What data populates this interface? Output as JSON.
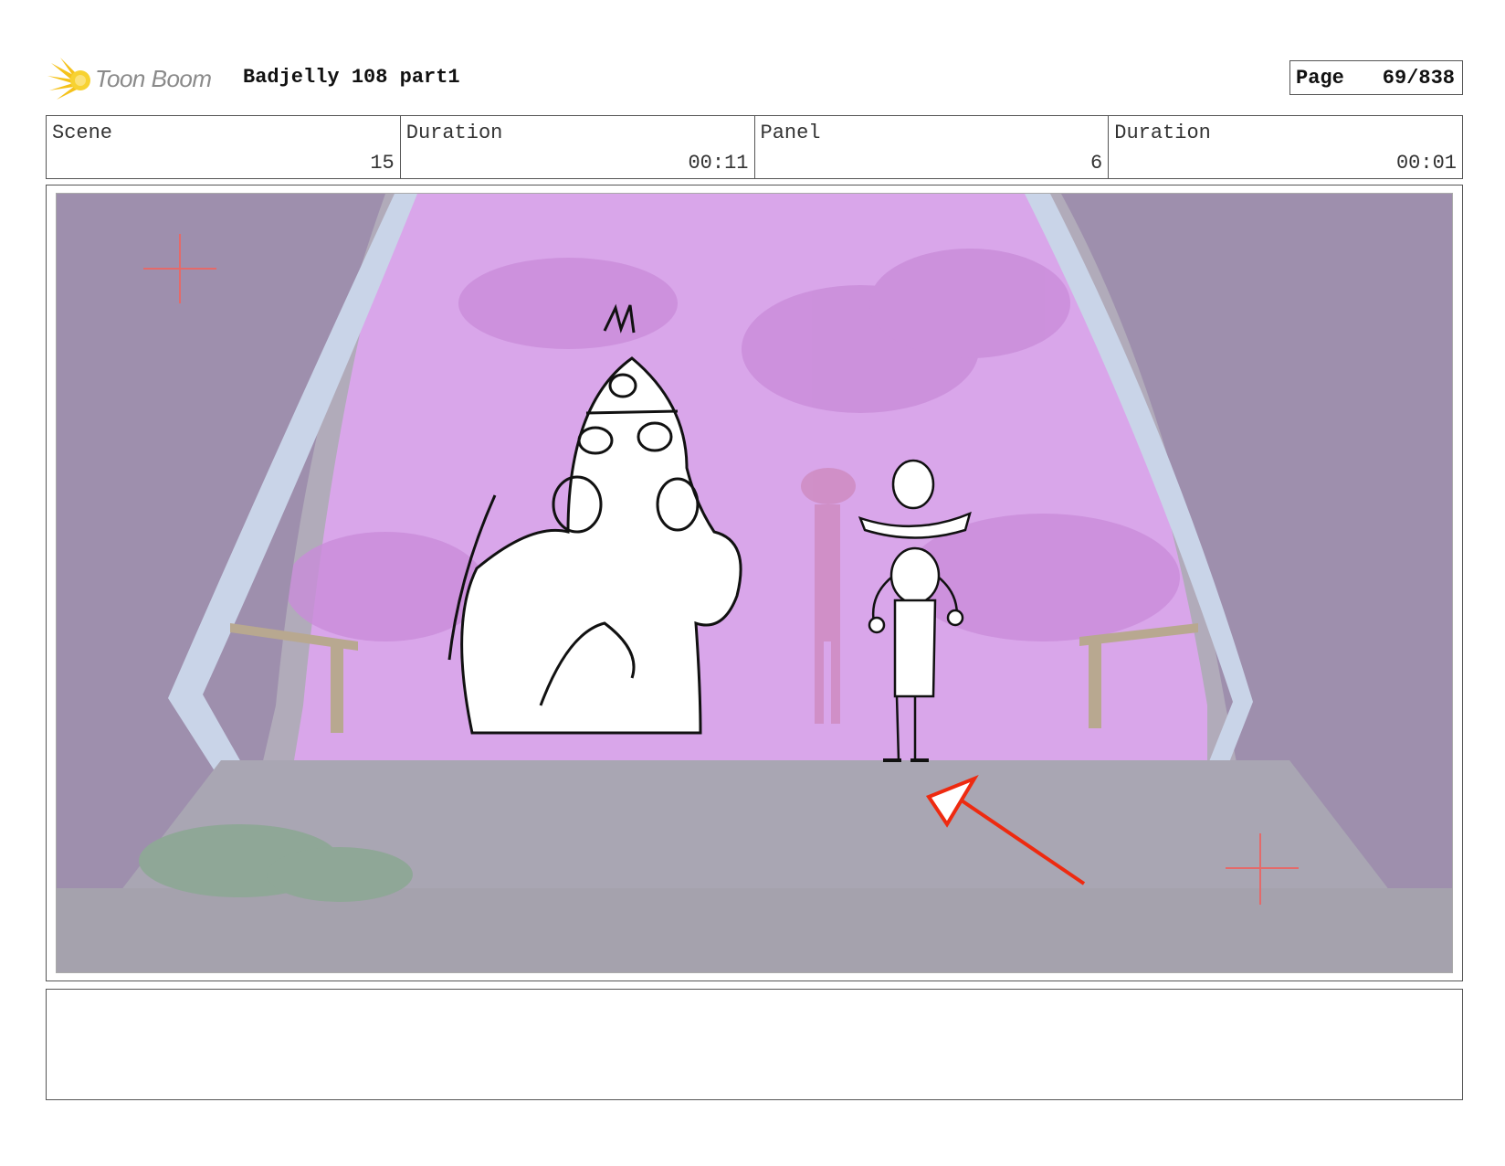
{
  "header": {
    "logo_text": "Toon Boom",
    "title": "Badjelly 108 part1",
    "page_label": "Page",
    "page_value": "69/838"
  },
  "info": {
    "scene_label": "Scene",
    "scene_value": "15",
    "scene_duration_label": "Duration",
    "scene_duration_value": "00:11",
    "panel_label": "Panel",
    "panel_value": "6",
    "panel_duration_label": "Duration",
    "panel_duration_value": "00:01"
  },
  "colors": {
    "sky": "#d9a6ea",
    "ground": "#a9a6b3",
    "arrow": "#ee2a10",
    "logo_yellow": "#f5c21b"
  },
  "notes": {
    "text": ""
  }
}
